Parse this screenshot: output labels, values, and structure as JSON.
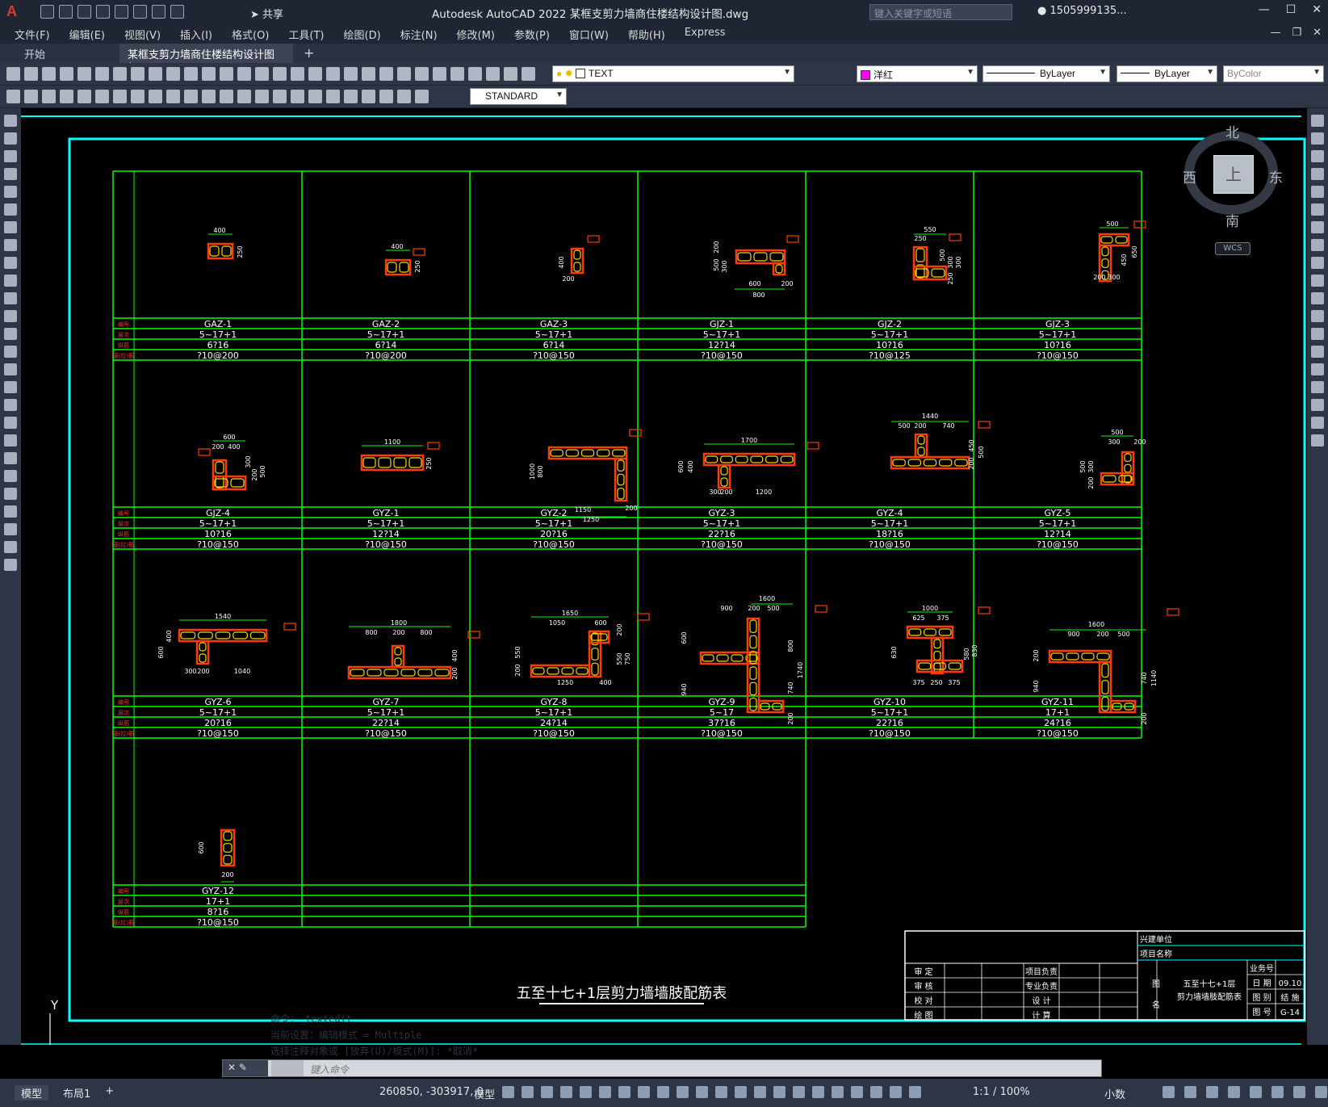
{
  "app": {
    "title": "Autodesk AutoCAD 2022    某框支剪力墙商住楼结构设计图.dwg",
    "share_label": "共享",
    "search_placeholder": "键入关键字或短语",
    "user": "1505999135...",
    "logo": "A"
  },
  "menu": {
    "items": [
      "文件(F)",
      "编辑(E)",
      "视图(V)",
      "插入(I)",
      "格式(O)",
      "工具(T)",
      "绘图(D)",
      "标注(N)",
      "修改(M)",
      "参数(P)",
      "窗口(W)",
      "帮助(H)",
      "Express"
    ]
  },
  "tabs": {
    "start": "开始",
    "active": "某框支剪力墙商住楼结构设计图*",
    "close": "✕",
    "plus": "+"
  },
  "toolbar": {
    "layer_combo": "TEXT",
    "color_combo": "洋红",
    "color_hex": "#ff00ff",
    "linetype_combo": "ByLayer",
    "lineweight_combo": "ByLayer",
    "plotstyle_combo": "ByColor",
    "textstyle_combo": "STANDARD"
  },
  "viewcube": {
    "north": "北",
    "south": "南",
    "east": "东",
    "west": "西",
    "face": "上",
    "wcs": "WCS"
  },
  "drawing": {
    "title": "五至十七+1层剪力墙墙肢配筋表",
    "row_labels": [
      "编号",
      "层次",
      "纵筋",
      "箍(拉)筋"
    ],
    "rows": [
      [
        {
          "id": "GAZ-1",
          "floors": "5~17+1",
          "long": "6?16",
          "stir": "?10@200"
        },
        {
          "id": "GAZ-2",
          "floors": "5~17+1",
          "long": "6?14",
          "stir": "?10@200"
        },
        {
          "id": "GAZ-3",
          "floors": "5~17+1",
          "long": "6?14",
          "stir": "?10@150"
        },
        {
          "id": "GJZ-1",
          "floors": "5~17+1",
          "long": "12?14",
          "stir": "?10@150"
        },
        {
          "id": "GJZ-2",
          "floors": "5~17+1",
          "long": "10?16",
          "stir": "?10@125"
        },
        {
          "id": "GJZ-3",
          "floors": "5~17+1",
          "long": "10?16",
          "stir": "?10@150"
        }
      ],
      [
        {
          "id": "GJZ-4",
          "floors": "5~17+1",
          "long": "10?16",
          "stir": "?10@150"
        },
        {
          "id": "GYZ-1",
          "floors": "5~17+1",
          "long": "12?14",
          "stir": "?10@150"
        },
        {
          "id": "GYZ-2",
          "floors": "5~17+1",
          "long": "20?16",
          "stir": "?10@150"
        },
        {
          "id": "GYZ-3",
          "floors": "5~17+1",
          "long": "22?16",
          "stir": "?10@150"
        },
        {
          "id": "GYZ-4",
          "floors": "5~17+1",
          "long": "18?16",
          "stir": "?10@150"
        },
        {
          "id": "GYZ-5",
          "floors": "5~17+1",
          "long": "12?14",
          "stir": "?10@150"
        }
      ],
      [
        {
          "id": "GYZ-6",
          "floors": "5~17+1",
          "long": "20?16",
          "stir": "?10@150"
        },
        {
          "id": "GYZ-7",
          "floors": "5~17+1",
          "long": "22?14",
          "stir": "?10@150"
        },
        {
          "id": "GYZ-8",
          "floors": "5~17+1",
          "long": "24?14",
          "stir": "?10@150"
        },
        {
          "id": "GYZ-9",
          "floors": "5~17",
          "long": "37?16",
          "stir": "?10@150"
        },
        {
          "id": "GYZ-10",
          "floors": "5~17+1",
          "long": "22?16",
          "stir": "?10@150"
        },
        {
          "id": "GYZ-11",
          "floors": "17+1",
          "long": "24?16",
          "stir": "?10@150"
        }
      ],
      [
        {
          "id": "GYZ-12",
          "floors": "17+1",
          "long": "8?16",
          "stir": "?10@150"
        }
      ]
    ],
    "dims": {
      "gaz1": [
        "400",
        "250"
      ],
      "gaz2": [
        "400",
        "250"
      ],
      "gaz3": [
        "400",
        "200"
      ],
      "gjz1": [
        "200",
        "500",
        "300",
        "600",
        "200",
        "800"
      ],
      "gjz2": [
        "550",
        "250",
        "300",
        "300",
        "500",
        "250"
      ],
      "gjz3": [
        "500",
        "450",
        "650",
        "200",
        "300"
      ],
      "gjz4": [
        "600",
        "200",
        "400",
        "200",
        "300",
        "500"
      ],
      "gyz1": [
        "1100",
        "250"
      ],
      "gyz2": [
        "1000",
        "800",
        "1150",
        "1250",
        "200"
      ],
      "gyz3": [
        "1700",
        "600",
        "400",
        "300",
        "200",
        "1200"
      ],
      "gyz4": [
        "1440",
        "500",
        "200",
        "740",
        "450",
        "200",
        "500"
      ],
      "gyz5": [
        "500",
        "300",
        "200",
        "500",
        "300",
        "200"
      ],
      "gyz6": [
        "1540",
        "600",
        "400",
        "300",
        "200",
        "1040"
      ],
      "gyz7": [
        "1800",
        "800",
        "200",
        "800",
        "400",
        "200"
      ],
      "gyz8": [
        "1650",
        "1050",
        "600",
        "550",
        "200",
        "1250",
        "400",
        "200",
        "550",
        "750"
      ],
      "gyz9": [
        "1600",
        "900",
        "200",
        "500",
        "600",
        "800",
        "940",
        "740",
        "1740",
        "200"
      ],
      "gyz10": [
        "1000",
        "625",
        "375",
        "630",
        "580",
        "830",
        "375",
        "250",
        "375"
      ],
      "gyz11": [
        "1600",
        "900",
        "200",
        "500",
        "200",
        "940",
        "740",
        "1140",
        "200"
      ],
      "gyz12": [
        "600",
        "200"
      ]
    },
    "title_block": {
      "build_unit": "兴建单位",
      "project_name": "项目名称",
      "roles_left": [
        "审 定",
        "审 核",
        "校 对",
        "绘 图"
      ],
      "roles_mid": [
        "项目负责",
        "专业负责",
        "设 计",
        "计 算"
      ],
      "figure_label": "图",
      "name_label": "名",
      "figure_name_1": "五至十七+1层",
      "figure_name_2": "剪力墙墙肢配筋表",
      "right_labels": [
        "业务号",
        "日 期",
        "图 别",
        "图 号"
      ],
      "right_values": [
        "",
        "09.10",
        "结 施",
        "G-14"
      ]
    }
  },
  "command": {
    "history": [
      "命令：_textedit",
      "当前设置：编辑模式 = Multiple",
      "选择注释对象或 [放弃(U)/模式(M)]: *取消*"
    ],
    "placeholder": "键入命令"
  },
  "ucs": {
    "x": "X",
    "y": "Y"
  },
  "status": {
    "tab_model": "模型",
    "tab_layout": "布局1",
    "plus": "+",
    "coords": "260850, -303917, 0",
    "mode": "模型",
    "scale": "1:1 / 100%",
    "units": "小数"
  }
}
